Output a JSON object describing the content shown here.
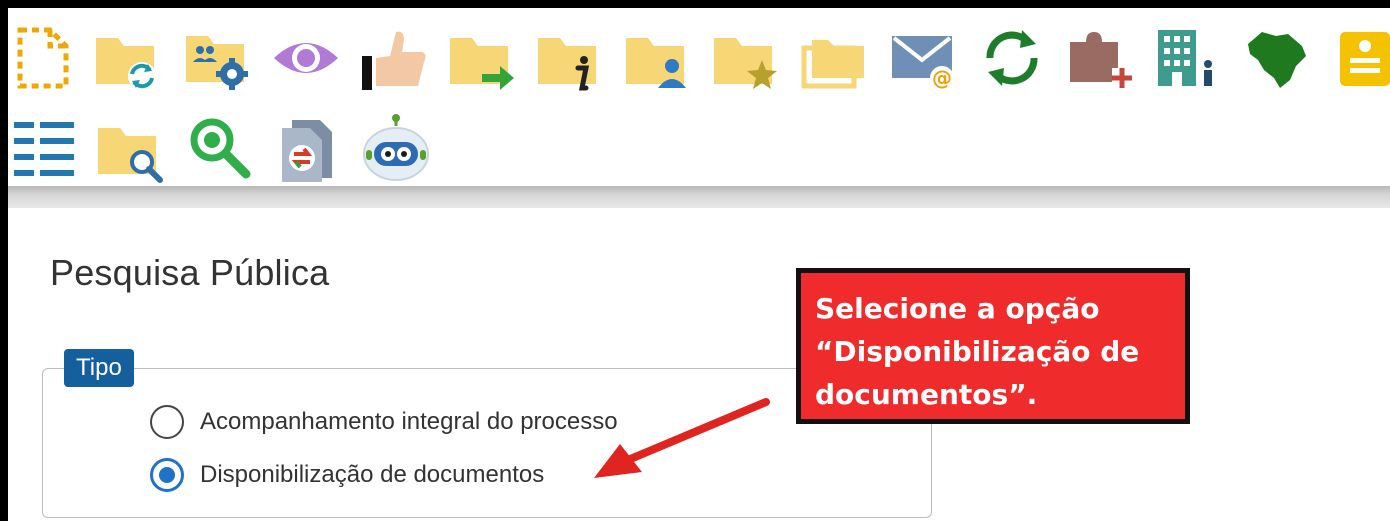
{
  "toolbar": {
    "icons": [
      "new-document-icon",
      "folder-sync-icon",
      "folder-users-settings-icon",
      "eye-icon",
      "thumbs-up-icon",
      "folder-forward-icon",
      "folder-info-icon",
      "folder-user-icon",
      "folder-star-icon",
      "folders-stack-icon",
      "email-icon",
      "refresh-icon",
      "puzzle-add-icon",
      "building-person-icon",
      "brazil-map-icon",
      "yellow-document-icon",
      "list-icon",
      "folder-search-icon",
      "zoom-icon",
      "document-transfer-icon",
      "robot-icon"
    ]
  },
  "page": {
    "title": "Pesquisa Pública"
  },
  "tipo": {
    "legend": "Tipo",
    "options": [
      {
        "label": "Acompanhamento integral do processo",
        "selected": false
      },
      {
        "label": "Disponibilização de documentos",
        "selected": true
      }
    ]
  },
  "callout": {
    "line1": "Selecione a opção",
    "line2": "“Disponibilização de",
    "line3": "documentos”."
  },
  "colors": {
    "accent": "#155f9d",
    "radio": "#1e73c8",
    "callout_bg": "#ef2b2b",
    "folder": "#f7d675"
  }
}
